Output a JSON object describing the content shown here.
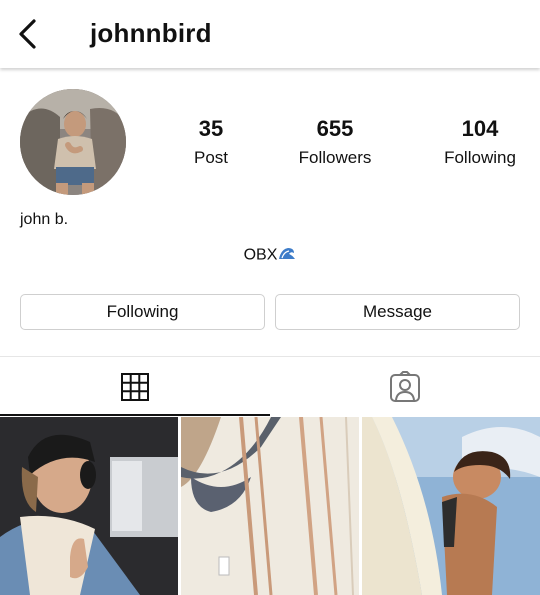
{
  "header": {
    "back_icon": "chevron-left-icon",
    "username": "johnnbird"
  },
  "profile": {
    "avatar_icon": "profile-photo",
    "stats": [
      {
        "value": "35",
        "label": "Post"
      },
      {
        "value": "655",
        "label": "Followers"
      },
      {
        "value": "104",
        "label": "Following"
      }
    ],
    "display_name": "john b.",
    "bio_text": "OBX",
    "bio_emoji": "wave-emoji"
  },
  "actions": {
    "following_label": "Following",
    "message_label": "Message"
  },
  "tabs": {
    "grid_icon": "grid-icon",
    "tagged_icon": "tagged-person-icon",
    "active": "grid"
  },
  "posts": [
    {
      "description_icon": "photo-thumbnail"
    },
    {
      "description_icon": "photo-thumbnail"
    },
    {
      "description_icon": "photo-thumbnail"
    }
  ],
  "colors": {
    "text": "#111111",
    "border": "#cfcfcf",
    "divider": "#e6e6e6"
  }
}
